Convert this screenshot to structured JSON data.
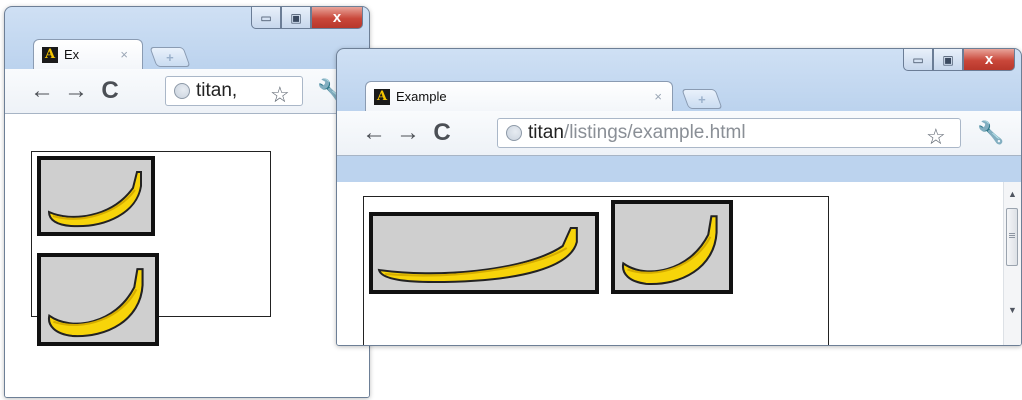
{
  "icons": {
    "favicon_letter": "A",
    "minimize": "minimize-icon",
    "maximize": "maximize-icon",
    "close": "close-icon",
    "back": "back-arrow-icon",
    "forward": "forward-arrow-icon",
    "reload": "reload-icon",
    "globe": "globe-icon",
    "star": "star-icon",
    "wrench": "wrench-icon",
    "banana": "banana-icon"
  },
  "colors": {
    "banana_fill": "#f7d40a",
    "image_background": "#cfcfcf",
    "close_button": "#c9473a"
  },
  "window1": {
    "tab_title": "Ex",
    "tab_close": "×",
    "url_host": "titan,",
    "url_rest": ""
  },
  "window2": {
    "tab_title": "Example",
    "tab_close": "×",
    "url_host": "titan",
    "url_rest": "/listings/example.html"
  },
  "glyphs": {
    "minimize": "▭",
    "maximize": "▣",
    "close": "x",
    "back": "←",
    "forward": "→",
    "reload": "C",
    "star": "☆",
    "wrench": "🔧",
    "newtab": "+",
    "scroll_up": "▲",
    "scroll_down": "▼"
  }
}
